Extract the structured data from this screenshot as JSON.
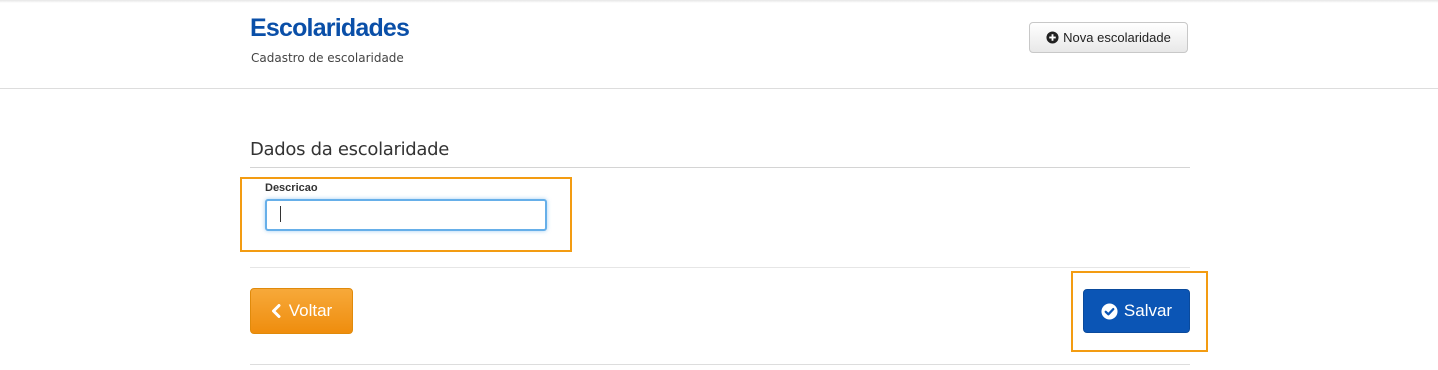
{
  "header": {
    "title": "Escolaridades",
    "subtitle": "Cadastro de escolaridade",
    "new_button_label": "Nova escolaridade",
    "new_button_icon": "plus-circle-icon"
  },
  "form": {
    "section_title": "Dados da escolaridade",
    "field_label": "Descricao",
    "field_value": "",
    "field_placeholder": ""
  },
  "actions": {
    "back_label": "Voltar",
    "back_icon": "chevron-left-icon",
    "save_label": "Salvar",
    "save_icon": "check-circle-icon"
  },
  "colors": {
    "brand_blue": "#0a4fa8",
    "save_blue": "#0b55b5",
    "back_orange": "#f39c12",
    "highlight_orange": "#f39c12",
    "focus_blue": "#66afe9"
  }
}
